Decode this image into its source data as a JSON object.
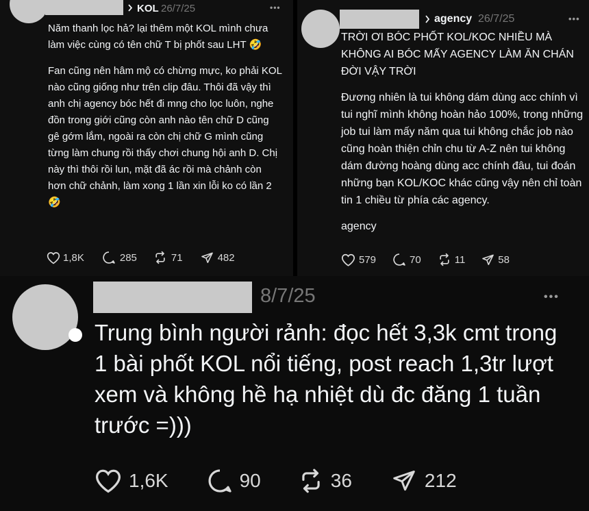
{
  "posts": [
    {
      "tag": "KOL",
      "date": "26/7/25",
      "more": "•••",
      "paragraphs": [
        "Năm thanh lọc hả? lại thêm một KOL mình chưa làm việc cùng có tên chữ T bị phốt sau LHT 🤣",
        "Fan cũng nên hâm mộ có chừng mực, ko phải KOL nào cũng giống như trên clip đâu. Thôi đã vậy thì anh chị agency bóc hết đi mng cho lọc luôn, nghe đồn trong giới cũng còn anh nào tên chữ D cũng gê gớm lắm, ngoài ra còn chị chữ G mình cũng từng làm chung rồi thấy chơi chung hội anh D. Chị này thì thôi rồi lun, mặt đã ác rồi mà chảnh còn hơn chữ chảnh, làm xong 1 lần xin lỗi ko có lần 2 🤣"
      ],
      "likes": "1,8K",
      "replies": "285",
      "reposts": "71",
      "shares": "482"
    },
    {
      "tag": "agency",
      "date": "26/7/25",
      "more": "•••",
      "paragraphs": [
        "TRỜI ƠI BÓC PHỐT KOL/KOC NHIỀU MÀ KHÔNG AI BÓC MẤY AGENCY LÀM ĂN CHÁN ĐỜI VẬY TRỜI",
        "Đương nhiên là tui không dám dùng acc chính vì tui nghĩ mình không hoàn hảo 100%, trong những job tui làm mấy năm qua tui không chắc job nào cũng hoàn thiện chỉn chu từ A-Z nên tui không dám đường hoàng dùng acc chính đâu, tui đoán những bạn KOL/KOC khác cũng vậy nên chỉ toàn tin 1 chiều từ phía các agency.",
        "agency"
      ],
      "likes": "579",
      "replies": "70",
      "reposts": "11",
      "shares": "58"
    },
    {
      "date": "8/7/25",
      "more": "•••",
      "paragraphs": [
        "Trung bình người rảnh: đọc hết 3,3k cmt trong 1 bài phốt KOL nổi tiếng, post reach 1,3tr lượt xem và không hề hạ nhiệt dù đc đăng 1 tuần trước =)))"
      ],
      "likes": "1,6K",
      "replies": "90",
      "reposts": "36",
      "shares": "212"
    }
  ],
  "colors": {
    "background": "#101010",
    "text": "#f3f5f7",
    "muted": "#777777",
    "redaction": "#c9c9c9"
  },
  "icons": {
    "like": "heart-icon",
    "reply": "comment-bubble-icon",
    "repost": "repost-icon",
    "share": "send-icon",
    "more": "more-dots-icon",
    "chevron": "chevron-right-icon"
  }
}
